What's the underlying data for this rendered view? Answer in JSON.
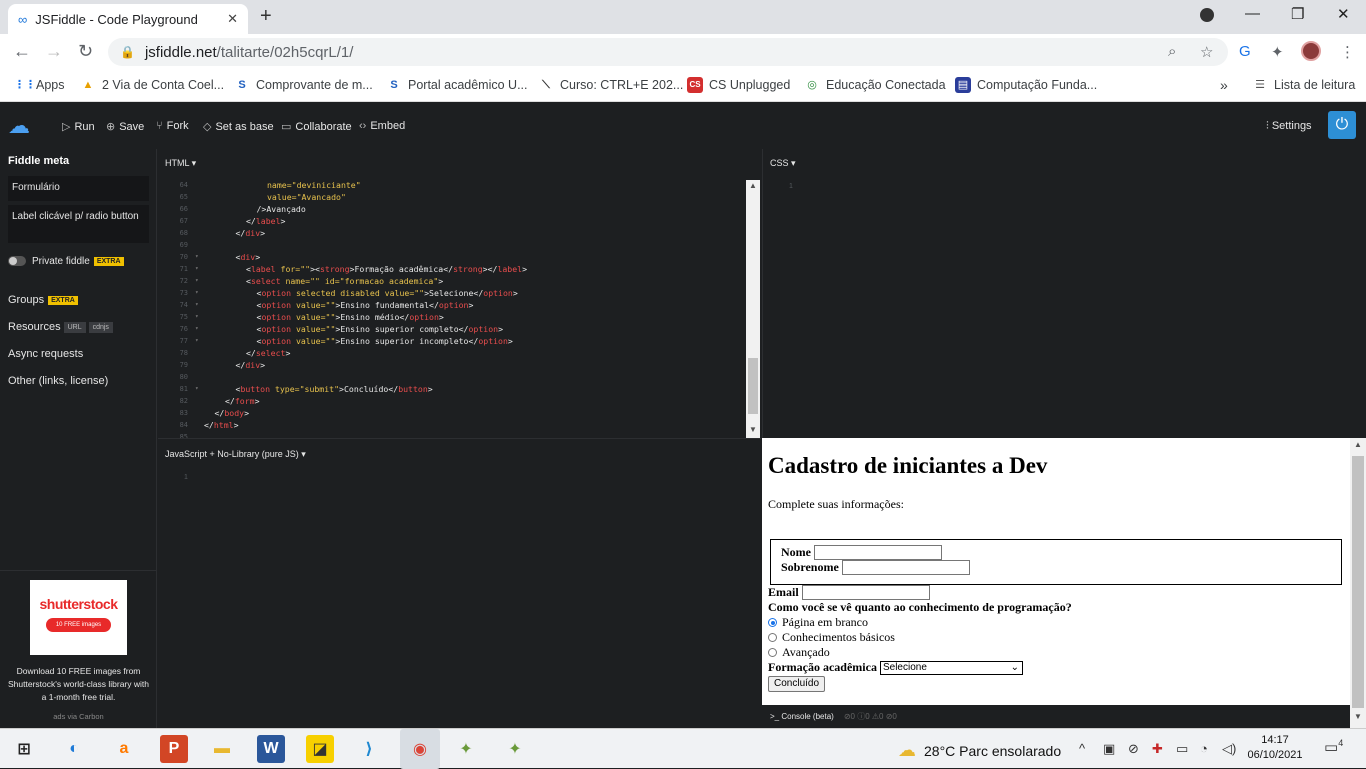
{
  "browser": {
    "tab_title": "JSFiddle - Code Playground",
    "url_domain": "jsfiddle.net",
    "url_path": "/talitarte/02h5cqrL/1/",
    "bookmarks": [
      "Apps",
      "2 Via de Conta Coel...",
      "Comprovante de m...",
      "Portal acadêmico U...",
      "Curso: CTRL+E 202...",
      "CS Unplugged",
      "Educação Conectada",
      "Computação Funda..."
    ],
    "reading_list": "Lista de leitura",
    "overflow": "»"
  },
  "toolbar": {
    "run": "Run",
    "save": "Save",
    "fork": "Fork",
    "set_as_base": "Set as base",
    "collaborate": "Collaborate",
    "embed": "Embed",
    "settings": "Settings"
  },
  "sidebar": {
    "title": "Fiddle meta",
    "fiddle_title": "Formulário",
    "fiddle_description": "Label clicável p/ radio button",
    "private_label": "Private fiddle",
    "extra_badge": "EXTRA",
    "groups": "Groups",
    "resources": "Resources",
    "url_badge": "URL",
    "cdnjs_badge": "cdnjs",
    "async": "Async requests",
    "other": "Other (links, license)",
    "ad_brand": "shutterstock",
    "ad_pill": "10 FREE images",
    "ad_text": "Download 10 FREE images from Shutterstock's world-class library with a 1-month free trial.",
    "ad_via": "ads via Carbon"
  },
  "panes": {
    "html_title": "HTML",
    "css_title": "CSS",
    "js_title": "JavaScript + No-Library (pure JS)",
    "css_line": "1",
    "js_line": "1"
  },
  "code_lines": [
    {
      "n": "64",
      "fold": "",
      "indent": 6,
      "parts": [
        [
          "attr",
          "name="
        ],
        [
          "str",
          "\"deviniciante\""
        ]
      ]
    },
    {
      "n": "65",
      "fold": "",
      "indent": 6,
      "parts": [
        [
          "attr",
          "value="
        ],
        [
          "str",
          "\"Avancado\""
        ]
      ]
    },
    {
      "n": "66",
      "fold": "",
      "indent": 5,
      "parts": [
        [
          "txt",
          "/>Avançado"
        ]
      ]
    },
    {
      "n": "67",
      "fold": "",
      "indent": 4,
      "parts": [
        [
          "txt",
          "</"
        ],
        [
          "tag",
          "label"
        ],
        [
          "txt",
          ">"
        ]
      ]
    },
    {
      "n": "68",
      "fold": "",
      "indent": 3,
      "parts": [
        [
          "txt",
          "</"
        ],
        [
          "tag",
          "div"
        ],
        [
          "txt",
          ">"
        ]
      ]
    },
    {
      "n": "69",
      "fold": "",
      "indent": 0,
      "parts": []
    },
    {
      "n": "70",
      "fold": "▾",
      "indent": 3,
      "parts": [
        [
          "txt",
          "<"
        ],
        [
          "tag",
          "div"
        ],
        [
          "txt",
          ">"
        ]
      ]
    },
    {
      "n": "71",
      "fold": "▾",
      "indent": 4,
      "parts": [
        [
          "txt",
          "<"
        ],
        [
          "tag",
          "label"
        ],
        [
          "attr",
          " for="
        ],
        [
          "str",
          "\"\""
        ],
        [
          "txt",
          "><"
        ],
        [
          "tag",
          "strong"
        ],
        [
          "txt",
          ">Formação acadêmica</"
        ],
        [
          "tag",
          "strong"
        ],
        [
          "txt",
          "></"
        ],
        [
          "tag",
          "label"
        ],
        [
          "txt",
          ">"
        ]
      ]
    },
    {
      "n": "72",
      "fold": "▾",
      "indent": 4,
      "parts": [
        [
          "txt",
          "<"
        ],
        [
          "tag",
          "select"
        ],
        [
          "attr",
          " name="
        ],
        [
          "str",
          "\"\""
        ],
        [
          "attr",
          " id="
        ],
        [
          "str",
          "\"formacao academica\""
        ],
        [
          "txt",
          ">"
        ]
      ]
    },
    {
      "n": "73",
      "fold": "▾",
      "indent": 5,
      "parts": [
        [
          "txt",
          "<"
        ],
        [
          "tag",
          "option"
        ],
        [
          "attr",
          " selected disabled value="
        ],
        [
          "str",
          "\"\""
        ],
        [
          "txt",
          ">Selecione</"
        ],
        [
          "tag",
          "option"
        ],
        [
          "txt",
          ">"
        ]
      ]
    },
    {
      "n": "74",
      "fold": "▾",
      "indent": 5,
      "parts": [
        [
          "txt",
          "<"
        ],
        [
          "tag",
          "option"
        ],
        [
          "attr",
          " value="
        ],
        [
          "str",
          "\"\""
        ],
        [
          "txt",
          ">Ensino fundamental</"
        ],
        [
          "tag",
          "option"
        ],
        [
          "txt",
          ">"
        ]
      ]
    },
    {
      "n": "75",
      "fold": "▾",
      "indent": 5,
      "parts": [
        [
          "txt",
          "<"
        ],
        [
          "tag",
          "option"
        ],
        [
          "attr",
          " value="
        ],
        [
          "str",
          "\"\""
        ],
        [
          "txt",
          ">Ensino médio</"
        ],
        [
          "tag",
          "option"
        ],
        [
          "txt",
          ">"
        ]
      ]
    },
    {
      "n": "76",
      "fold": "▾",
      "indent": 5,
      "parts": [
        [
          "txt",
          "<"
        ],
        [
          "tag",
          "option"
        ],
        [
          "attr",
          " value="
        ],
        [
          "str",
          "\"\""
        ],
        [
          "txt",
          ">Ensino superior completo</"
        ],
        [
          "tag",
          "option"
        ],
        [
          "txt",
          ">"
        ]
      ]
    },
    {
      "n": "77",
      "fold": "▾",
      "indent": 5,
      "parts": [
        [
          "txt",
          "<"
        ],
        [
          "tag",
          "option"
        ],
        [
          "attr",
          " value="
        ],
        [
          "str",
          "\"\""
        ],
        [
          "txt",
          ">Ensino superior incompleto</"
        ],
        [
          "tag",
          "option"
        ],
        [
          "txt",
          ">"
        ]
      ]
    },
    {
      "n": "78",
      "fold": "",
      "indent": 4,
      "parts": [
        [
          "txt",
          "</"
        ],
        [
          "tag",
          "select"
        ],
        [
          "txt",
          ">"
        ]
      ]
    },
    {
      "n": "79",
      "fold": "",
      "indent": 3,
      "parts": [
        [
          "txt",
          "</"
        ],
        [
          "tag",
          "div"
        ],
        [
          "txt",
          ">"
        ]
      ]
    },
    {
      "n": "80",
      "fold": "",
      "indent": 0,
      "parts": []
    },
    {
      "n": "81",
      "fold": "▾",
      "indent": 3,
      "parts": [
        [
          "txt",
          "<"
        ],
        [
          "tag",
          "button"
        ],
        [
          "attr",
          " type="
        ],
        [
          "str",
          "\"submit\""
        ],
        [
          "txt",
          ">Concluído</"
        ],
        [
          "tag",
          "button"
        ],
        [
          "txt",
          ">"
        ]
      ]
    },
    {
      "n": "82",
      "fold": "",
      "indent": 2,
      "parts": [
        [
          "txt",
          "</"
        ],
        [
          "tag",
          "form"
        ],
        [
          "txt",
          ">"
        ]
      ]
    },
    {
      "n": "83",
      "fold": "",
      "indent": 1,
      "parts": [
        [
          "txt",
          "</"
        ],
        [
          "tag",
          "body"
        ],
        [
          "txt",
          ">"
        ]
      ]
    },
    {
      "n": "84",
      "fold": "",
      "indent": 0,
      "parts": [
        [
          "txt",
          "</"
        ],
        [
          "tag",
          "html"
        ],
        [
          "txt",
          ">"
        ]
      ]
    },
    {
      "n": "85",
      "fold": "",
      "indent": 0,
      "parts": []
    }
  ],
  "result": {
    "heading": "Cadastro de iniciantes a Dev",
    "intro": "Complete suas informações:",
    "nome_label": "Nome",
    "sobrenome_label": "Sobrenome",
    "email_label": "Email",
    "question": "Como você se vê quanto ao conhecimento de programação?",
    "options": [
      "Página em branco",
      "Conhecimentos básicos",
      "Avançado"
    ],
    "selected_option_index": 0,
    "formacao_label": "Formação acadêmica",
    "select_value": "Selecione",
    "submit_label": "Concluído"
  },
  "console": {
    "label": "Console (beta)",
    "counts": "⊘0 ⓘ0 ⚠0 ⊘0"
  },
  "taskbar": {
    "weather": "28°C  Parc ensolarado",
    "time": "14:17",
    "date": "06/10/2021",
    "notifications": "4"
  },
  "colors": {
    "jsfiddle_bg": "#1d1f21",
    "accent": "#2d8fd5",
    "tag": "#e84d4d",
    "attr": "#e6c14d"
  }
}
